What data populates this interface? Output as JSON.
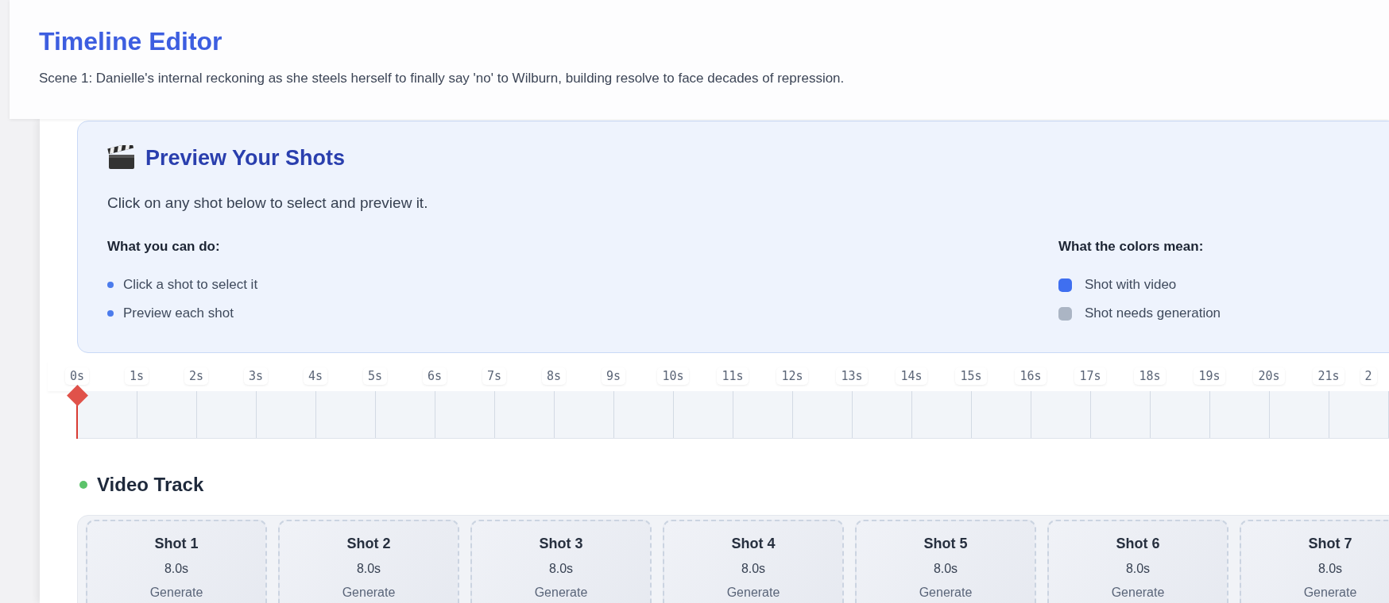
{
  "header": {
    "title": "Timeline Editor",
    "subtitle": "Scene 1: Danielle's internal reckoning as she steels herself to finally say 'no' to Wilburn, building resolve to face decades of repression."
  },
  "preview": {
    "title": "Preview Your Shots",
    "instruction": "Click on any shot below to select and preview it.",
    "actions": {
      "heading": "What you can do:",
      "items": [
        "Click a shot to select it",
        "Preview each shot"
      ]
    },
    "legend": {
      "heading": "What the colors mean:",
      "items": [
        {
          "label": "Shot with video",
          "color": "#3f6ff0"
        },
        {
          "label": "Shot needs generation",
          "color": "#abb5c4"
        }
      ]
    }
  },
  "ruler": {
    "labels": [
      "0s",
      "1s",
      "2s",
      "3s",
      "4s",
      "5s",
      "6s",
      "7s",
      "8s",
      "9s",
      "10s",
      "11s",
      "12s",
      "13s",
      "14s",
      "15s",
      "16s",
      "17s",
      "18s",
      "19s",
      "20s",
      "21s",
      "2"
    ]
  },
  "video_track": {
    "title": "Video Track",
    "shots": [
      {
        "name": "Shot 1",
        "duration": "8.0s",
        "status": "Generate",
        "has_video": false
      },
      {
        "name": "Shot 2",
        "duration": "8.0s",
        "status": "Generate",
        "has_video": false
      },
      {
        "name": "Shot 3",
        "duration": "8.0s",
        "status": "Generate",
        "has_video": false
      },
      {
        "name": "Shot 4",
        "duration": "8.0s",
        "status": "Generate",
        "has_video": false
      },
      {
        "name": "Shot 5",
        "duration": "8.0s",
        "status": "Generate",
        "has_video": false
      },
      {
        "name": "Shot 6",
        "duration": "8.0s",
        "status": "Generate",
        "has_video": false
      },
      {
        "name": "Shot 7",
        "duration": "8.0s",
        "status": "Generate",
        "has_video": false
      }
    ]
  }
}
